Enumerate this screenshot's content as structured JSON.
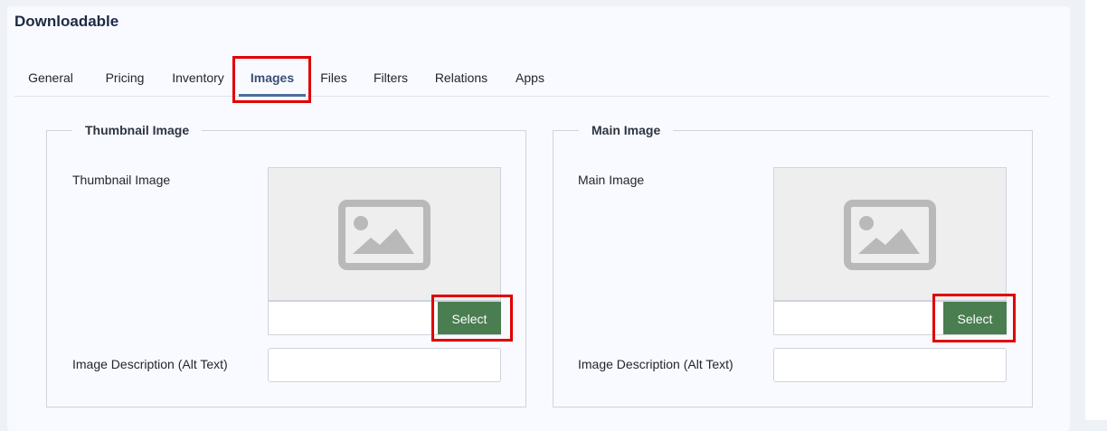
{
  "page": {
    "title": "Downloadable"
  },
  "tabs": [
    {
      "label": "General"
    },
    {
      "label": "Pricing"
    },
    {
      "label": "Inventory"
    },
    {
      "label": "Images"
    },
    {
      "label": "Files"
    },
    {
      "label": "Filters"
    },
    {
      "label": "Relations"
    },
    {
      "label": "Apps"
    }
  ],
  "active_tab": "Images",
  "thumbnail": {
    "legend": "Thumbnail Image",
    "image_label": "Thumbnail Image",
    "select_label": "Select",
    "alt_label": "Image Description (Alt Text)",
    "path_value": "",
    "alt_value": ""
  },
  "main_image": {
    "legend": "Main Image",
    "image_label": "Main Image",
    "select_label": "Select",
    "alt_label": "Image Description (Alt Text)",
    "path_value": "",
    "alt_value": ""
  },
  "colors": {
    "accent": "#4e6e9b",
    "select_button": "#4a7d50",
    "highlight": "#e00000"
  },
  "icons": {
    "placeholder": "image-placeholder-icon"
  }
}
